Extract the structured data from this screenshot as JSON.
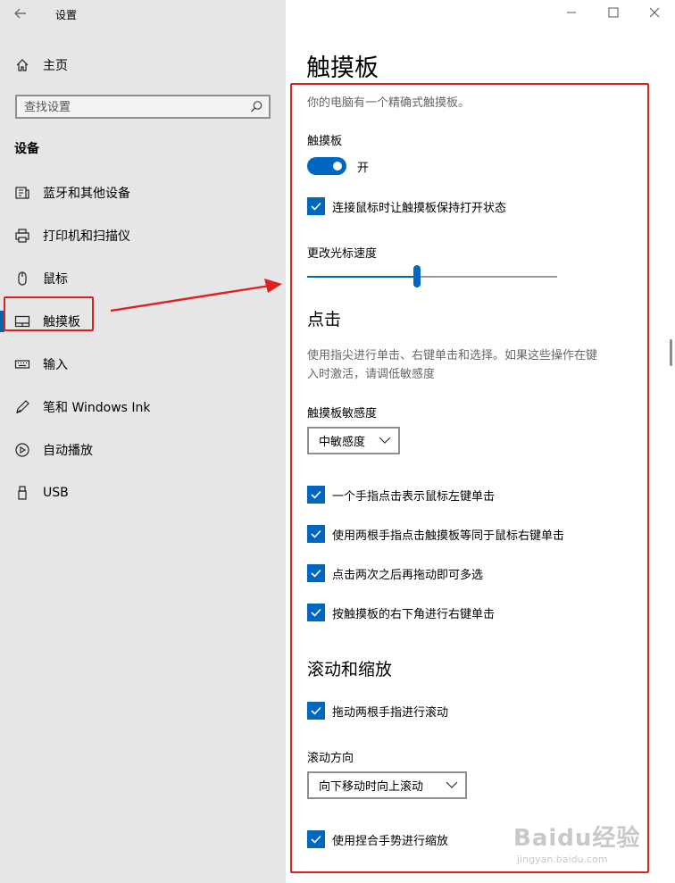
{
  "window": {
    "title": "设置",
    "back_icon": "back-arrow-icon",
    "controls": [
      "minimize-icon",
      "maximize-icon",
      "close-icon"
    ]
  },
  "sidebar": {
    "home_label": "主页",
    "search_placeholder": "查找设置",
    "section_title": "设备",
    "items": [
      {
        "label": "蓝牙和其他设备",
        "icon": "bluetooth-devices-icon"
      },
      {
        "label": "打印机和扫描仪",
        "icon": "printer-icon"
      },
      {
        "label": "鼠标",
        "icon": "mouse-icon"
      },
      {
        "label": "触摸板",
        "icon": "touchpad-icon",
        "active": true
      },
      {
        "label": "输入",
        "icon": "keyboard-icon"
      },
      {
        "label": "笔和 Windows Ink",
        "icon": "pen-icon"
      },
      {
        "label": "自动播放",
        "icon": "autoplay-icon"
      },
      {
        "label": "USB",
        "icon": "usb-icon"
      }
    ]
  },
  "main": {
    "title": "触摸板",
    "precision_note": "你的电脑有一个精确式触摸板。",
    "touchpad_label": "触摸板",
    "touchpad_toggle_state": "开",
    "keep_on_with_mouse": "连接鼠标时让触摸板保持打开状态",
    "cursor_speed_label": "更改光标速度",
    "cursor_speed_fraction": 0.44,
    "taps": {
      "heading": "点击",
      "desc_line1": "使用指尖进行单击、右键单击和选择。如果这些操作在键",
      "desc_line2": "入时激活，请调低敏感度",
      "sensitivity_label": "触摸板敏感度",
      "sensitivity_value": "中敏感度",
      "options": [
        "一个手指点击表示鼠标左键单击",
        "使用两根手指点击触摸板等同于鼠标右键单击",
        "点击两次之后再拖动即可多选",
        "按触摸板的右下角进行右键单击"
      ]
    },
    "scroll": {
      "heading": "滚动和缩放",
      "drag_two_fingers": "拖动两根手指进行滚动",
      "direction_label": "滚动方向",
      "direction_value": "向下移动时向上滚动",
      "pinch_zoom": "使用捏合手势进行缩放"
    }
  },
  "watermark": {
    "brand": "Baidu经验",
    "url": "jingyan.baidu.com"
  },
  "colors": {
    "accent": "#0067c0",
    "highlight": "#e02020",
    "sidebar_bg": "#e6e6e6"
  }
}
